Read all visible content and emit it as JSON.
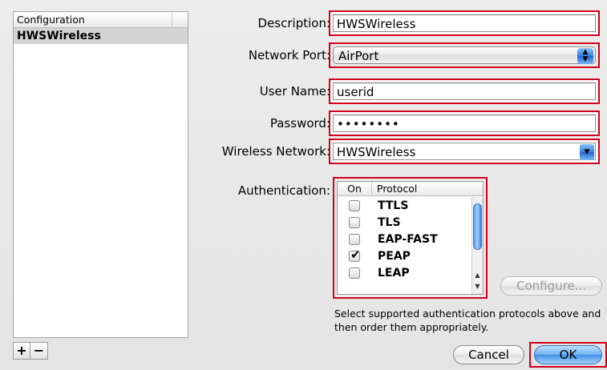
{
  "config_list": {
    "header": "Configuration",
    "items": [
      "HWSWireless"
    ]
  },
  "buttons": {
    "add": "+",
    "remove": "−",
    "configure": "Configure...",
    "cancel": "Cancel",
    "ok": "OK"
  },
  "form": {
    "description": {
      "label": "Description:",
      "value": "HWSWireless"
    },
    "network_port": {
      "label": "Network Port:",
      "value": "AirPort"
    },
    "user_name": {
      "label": "User Name:",
      "value": "userid"
    },
    "password": {
      "label": "Password:",
      "value": "••••••••"
    },
    "wireless_network": {
      "label": "Wireless Network:",
      "value": "HWSWireless"
    },
    "authentication": {
      "label": "Authentication:"
    }
  },
  "auth_table": {
    "col_on": "On",
    "col_protocol": "Protocol",
    "rows": [
      {
        "name": "TTLS",
        "on": false
      },
      {
        "name": "TLS",
        "on": false
      },
      {
        "name": "EAP-FAST",
        "on": false
      },
      {
        "name": "PEAP",
        "on": true
      },
      {
        "name": "LEAP",
        "on": false
      }
    ]
  },
  "help_text": "Select supported authentication protocols above and then order them appropriately.",
  "colors": {
    "highlight": "#d0001b",
    "accent": "#2e7ee0"
  }
}
